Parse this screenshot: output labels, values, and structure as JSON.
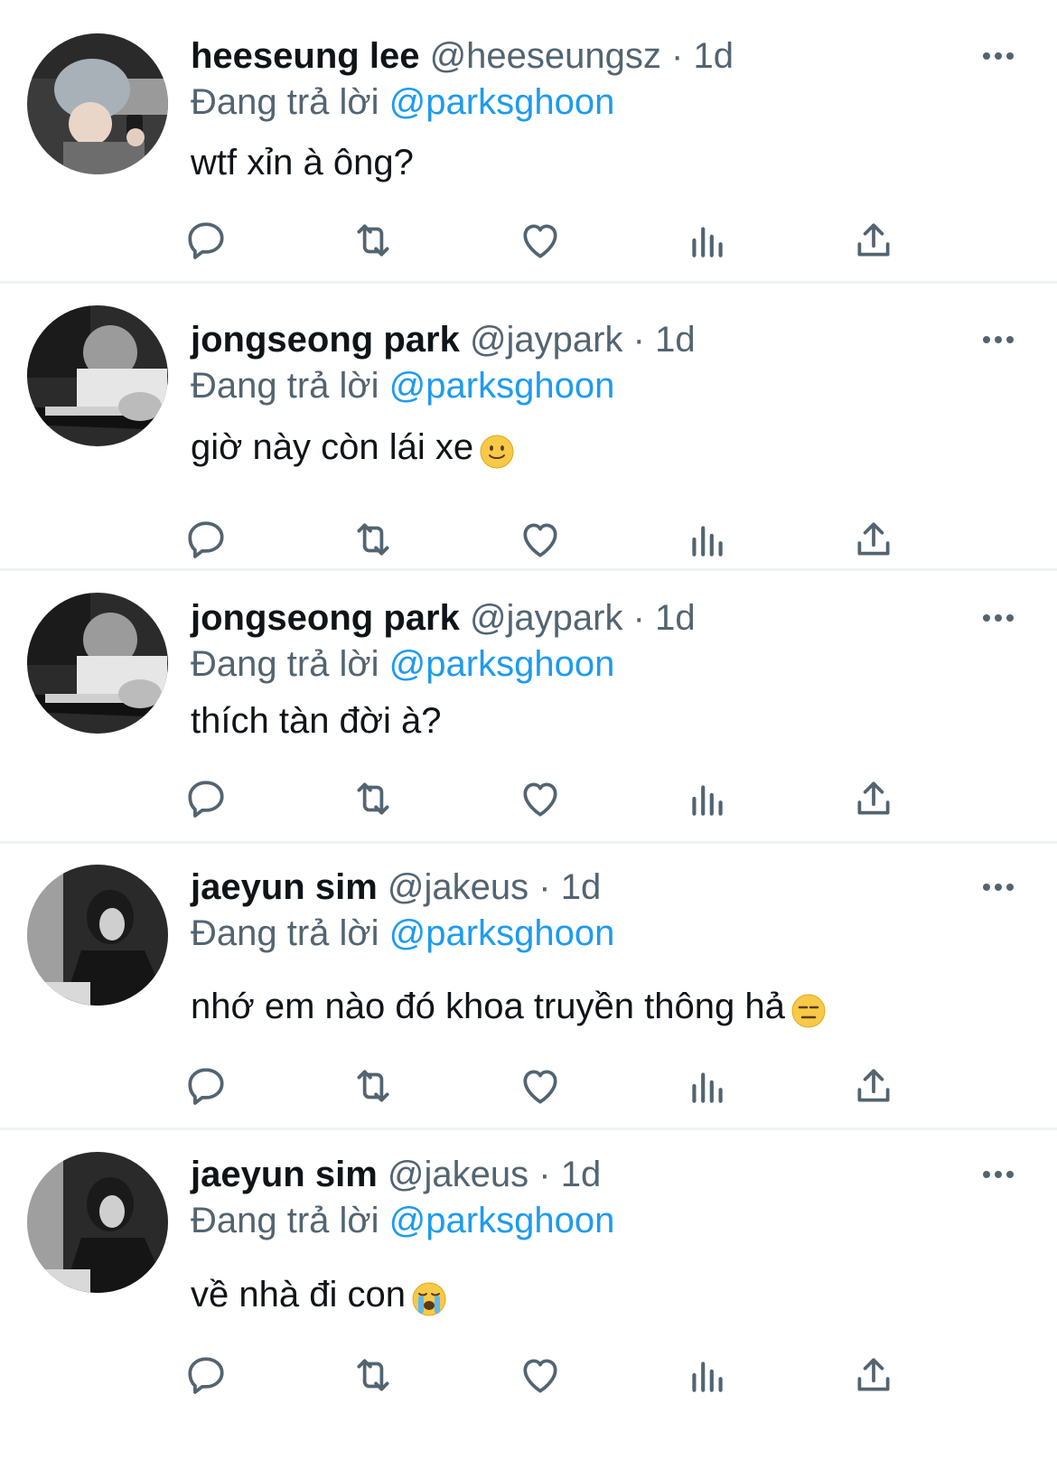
{
  "reply_prefix": "Đang trả lời",
  "colors": {
    "name": "#0f1419",
    "meta": "#536471",
    "link": "#1d9bf0",
    "divider": "#eff3f4"
  },
  "icons": {
    "more": "more-dots-icon",
    "reply": "reply-icon",
    "retweet": "retweet-icon",
    "like": "heart-icon",
    "views": "analytics-icon",
    "share": "share-icon"
  },
  "tweets": [
    {
      "name": "heeseung lee",
      "handle": "@heeseungsz",
      "sep": "·",
      "time": "1d",
      "reply_to": "@parksghoon",
      "text": "wtf xỉn à ông?",
      "emoji": ""
    },
    {
      "name": "jongseong park",
      "handle": "@jaypark",
      "sep": "·",
      "time": "1d",
      "reply_to": "@parksghoon",
      "text": "giờ này còn lái xe",
      "emoji": "slightly-smiling-face"
    },
    {
      "name": "jongseong park",
      "handle": "@jaypark",
      "sep": "·",
      "time": "1d",
      "reply_to": "@parksghoon",
      "text": "thích tàn đời à?",
      "emoji": ""
    },
    {
      "name": "jaeyun sim",
      "handle": "@jakeus",
      "sep": "·",
      "time": "1d",
      "reply_to": "@parksghoon",
      "text": "nhớ em nào đó khoa truyền thông hả",
      "emoji": "expressionless-face"
    },
    {
      "name": "jaeyun sim",
      "handle": "@jakeus",
      "sep": "·",
      "time": "1d",
      "reply_to": "@parksghoon",
      "text": "về nhà đi con",
      "emoji": "loudly-crying-face"
    }
  ]
}
